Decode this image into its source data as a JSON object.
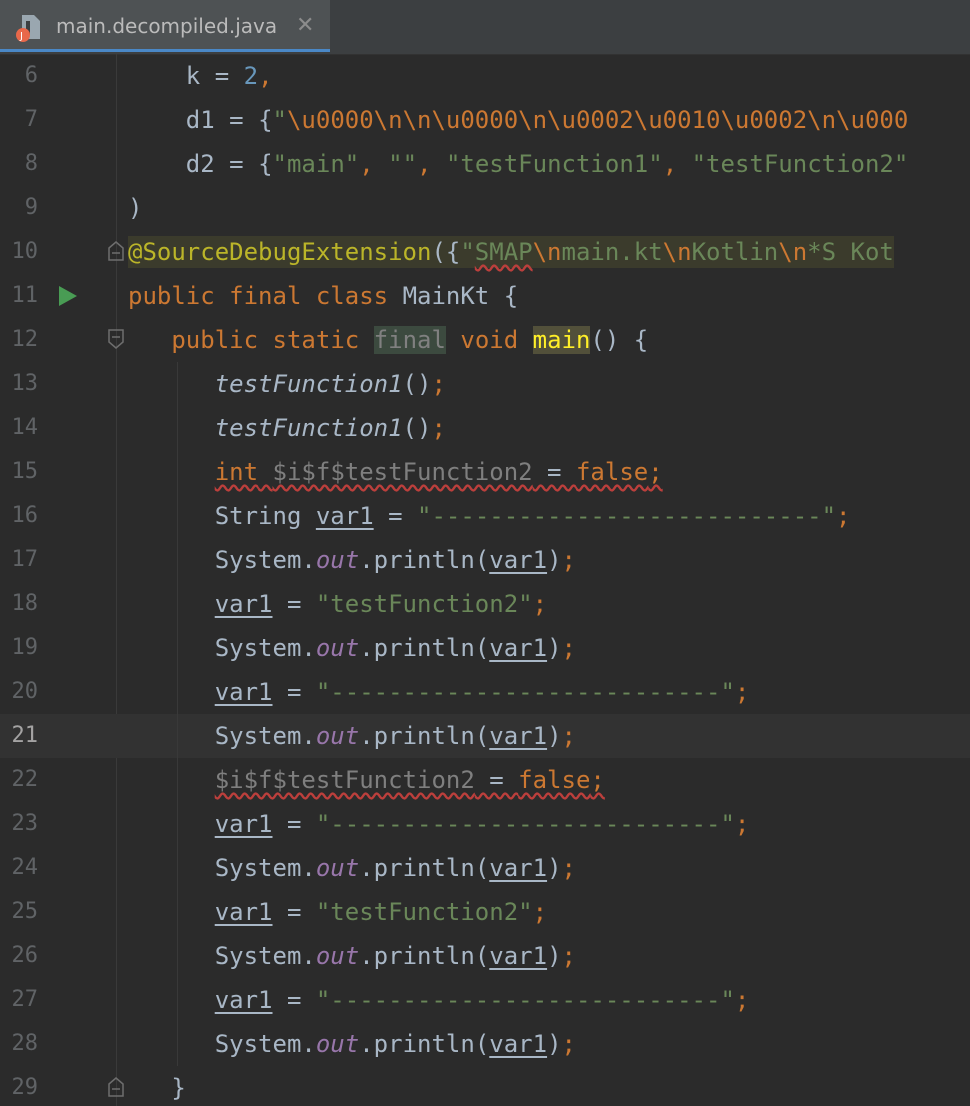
{
  "tab": {
    "title": "main.decompiled.java",
    "close_glyph": "✕",
    "file_icon": "java-class-file-icon"
  },
  "editor": {
    "current_line": "21",
    "lines": [
      {
        "n": "6"
      },
      {
        "n": "7"
      },
      {
        "n": "8"
      },
      {
        "n": "9"
      },
      {
        "n": "10"
      },
      {
        "n": "11"
      },
      {
        "n": "12"
      },
      {
        "n": "13"
      },
      {
        "n": "14"
      },
      {
        "n": "15"
      },
      {
        "n": "16"
      },
      {
        "n": "17"
      },
      {
        "n": "18"
      },
      {
        "n": "19"
      },
      {
        "n": "20"
      },
      {
        "n": "21"
      },
      {
        "n": "22"
      },
      {
        "n": "23"
      },
      {
        "n": "24"
      },
      {
        "n": "25"
      },
      {
        "n": "26"
      },
      {
        "n": "27"
      },
      {
        "n": "28"
      },
      {
        "n": "29"
      }
    ],
    "code": {
      "l6": {
        "ident": "k",
        "op": " = ",
        "num": "2",
        "tail": ","
      },
      "l7": {
        "ident": "d1",
        "op": " = ",
        "brace": "{",
        "str_open": "\"",
        "esc1": "\\u0000\\n\\n\\u0000\\n\\u0002\\u0010\\u0002\\n\\u000"
      },
      "l8": {
        "ident": "d2",
        "op": " = ",
        "brace": "{",
        "s1": "\"main\"",
        "c1": ", ",
        "s2": "\"\"",
        "c2": ", ",
        "s3": "\"testFunction1\"",
        "c3": ", ",
        "s4": "\"testFunction2\""
      },
      "l9": {
        "text": ")"
      },
      "l10": {
        "ann": "@SourceDebugExtension",
        "paren": "({",
        "q": "\"",
        "smap": "SMAP",
        "e1": "\\n",
        "t1": "main.kt",
        "e2": "\\n",
        "t2": "Kotlin",
        "e3": "\\n",
        "t3": "*S Kot"
      },
      "l11": {
        "kw1": "public",
        "kw2": "final",
        "kw3": "class",
        "name": "MainKt",
        "brace": " {"
      },
      "l12": {
        "kw1": "public",
        "kw2": "static",
        "kw3": "final",
        "kw4": "void",
        "name": "main",
        "tail": "() {"
      },
      "l13": {
        "call": "testFunction1",
        "tail": "()",
        "semi": ";"
      },
      "l14": {
        "call": "testFunction1",
        "tail": "()",
        "semi": ";"
      },
      "l15": {
        "kw": "int",
        "ident": "$i$f$testFunction2",
        "op": " = ",
        "val": "false",
        "semi": ";"
      },
      "l16": {
        "type": "String",
        "var": "var1",
        "op": " = ",
        "str": "\"---------------------------\"",
        "semi": ";"
      },
      "println": {
        "cls": "System.",
        "field": "out",
        "meth": ".println(",
        "arg": "var1",
        "close": ")",
        "semi": ";"
      },
      "l18": {
        "var": "var1",
        "op": " = ",
        "str": "\"testFunction2\"",
        "semi": ";"
      },
      "l20": {
        "var": "var1",
        "op": " = ",
        "str": "\"---------------------------\"",
        "semi": ";"
      },
      "l22": {
        "ident": "$i$f$testFunction2",
        "op": " = ",
        "val": "false",
        "semi": ";"
      },
      "l29": {
        "text": "}"
      }
    }
  },
  "colors": {
    "background": "#2b2b2b",
    "keyword": "#cc7832",
    "string": "#6a8759",
    "number": "#6897bb",
    "annotation": "#bbb529",
    "field": "#9876aa",
    "text": "#a9b7c6",
    "run_icon": "#499c54"
  }
}
